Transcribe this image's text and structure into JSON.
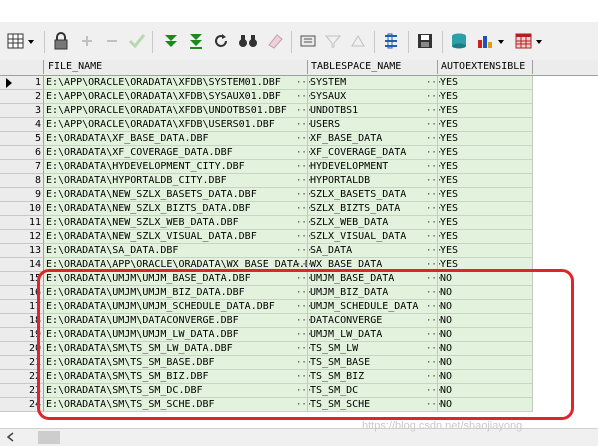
{
  "columns": [
    "FILE_NAME",
    "TABLESPACE_NAME",
    "AUTOEXTENSIBLE"
  ],
  "ellipsis": "···",
  "rows": [
    [
      "1",
      "E:\\APP\\ORACLE\\ORADATA\\XFDB\\SYSTEM01.DBF",
      "SYSTEM",
      "YES"
    ],
    [
      "2",
      "E:\\APP\\ORACLE\\ORADATA\\XFDB\\SYSAUX01.DBF",
      "SYSAUX",
      "YES"
    ],
    [
      "3",
      "E:\\APP\\ORACLE\\ORADATA\\XFDB\\UNDOTBS01.DBF",
      "UNDOTBS1",
      "YES"
    ],
    [
      "4",
      "E:\\APP\\ORACLE\\ORADATA\\XFDB\\USERS01.DBF",
      "USERS",
      "YES"
    ],
    [
      "5",
      "E:\\ORADATA\\XF_BASE_DATA.DBF",
      "XF_BASE_DATA",
      "YES"
    ],
    [
      "6",
      "E:\\ORADATA\\XF_COVERAGE_DATA.DBF",
      "XF_COVERAGE_DATA",
      "YES"
    ],
    [
      "7",
      "E:\\ORADATA\\HYDEVELOPMENT_CITY.DBF",
      "HYDEVELOPMENT",
      "YES"
    ],
    [
      "8",
      "E:\\ORADATA\\HYPORTALDB_CITY.DBF",
      "HYPORTALDB",
      "YES"
    ],
    [
      "9",
      "E:\\ORADATA\\NEW_SZLX_BASETS_DATA.DBF",
      "SZLX_BASETS_DATA",
      "YES"
    ],
    [
      "10",
      "E:\\ORADATA\\NEW_SZLX_BIZTS_DATA.DBF",
      "SZLX_BIZTS_DATA",
      "YES"
    ],
    [
      "11",
      "E:\\ORADATA\\NEW_SZLX_WEB_DATA.DBF",
      "SZLX_WEB_DATA",
      "YES"
    ],
    [
      "12",
      "E:\\ORADATA\\NEW_SZLX_VISUAL_DATA.DBF",
      "SZLX_VISUAL_DATA",
      "YES"
    ],
    [
      "13",
      "E:\\ORADATA\\SA_DATA.DBF",
      "SA_DATA",
      "YES"
    ],
    [
      "14",
      "E:\\ORADATA\\APP\\ORACLE\\ORADATA\\WX_BASE_DATA.DBF",
      "WX_BASE_DATA",
      "YES"
    ],
    [
      "15",
      "E:\\ORADATA\\UMJM\\UMJM_BASE_DATA.DBF",
      "UMJM_BASE_DATA",
      "NO"
    ],
    [
      "16",
      "E:\\ORADATA\\UMJM\\UMJM_BIZ_DATA.DBF",
      "UMJM_BIZ_DATA",
      "NO"
    ],
    [
      "17",
      "E:\\ORADATA\\UMJM\\UMJM_SCHEDULE_DATA.DBF",
      "UMJM_SCHEDULE_DATA",
      "NO"
    ],
    [
      "18",
      "E:\\ORADATA\\UMJM\\DATACONVERGE.DBF",
      "DATACONVERGE",
      "NO"
    ],
    [
      "19",
      "E:\\ORADATA\\UMJM\\UMJM_LW_DATA.DBF",
      "UMJM_LW_DATA",
      "NO"
    ],
    [
      "20",
      "E:\\ORADATA\\SM\\TS_SM_LW_DATA.DBF",
      "TS_SM_LW",
      "NO"
    ],
    [
      "21",
      "E:\\ORADATA\\SM\\TS_SM_BASE.DBF",
      "TS_SM_BASE",
      "NO"
    ],
    [
      "22",
      "E:\\ORADATA\\SM\\TS_SM_BIZ.DBF",
      "TS_SM_BIZ",
      "NO"
    ],
    [
      "23",
      "E:\\ORADATA\\SM\\TS_SM_DC.DBF",
      "TS_SM_DC",
      "NO"
    ],
    [
      "24",
      "E:\\ORADATA\\SM\\TS_SM_SCHE.DBF",
      "TS_SM_SCHE",
      "NO"
    ]
  ],
  "watermark": "https://blog.csdn.net/shaojiayong",
  "colors": {
    "row_bg": "#e3f2dc",
    "highlight": "#e0242a"
  }
}
